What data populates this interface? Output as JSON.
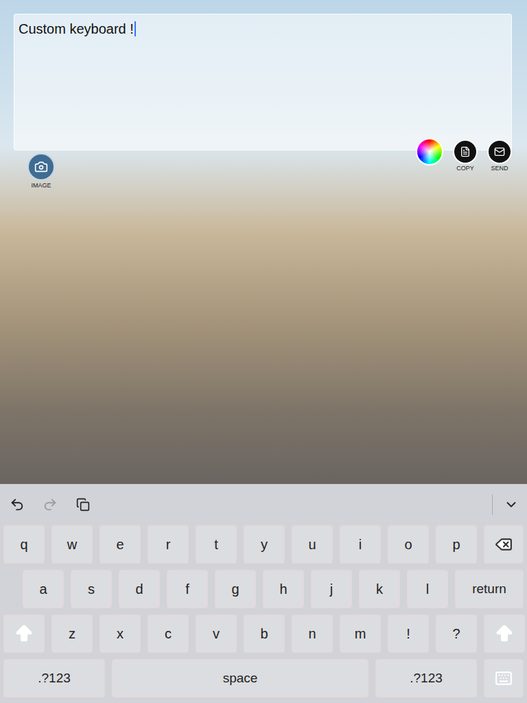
{
  "editor": {
    "text": "Custom keyboard !",
    "focused": true
  },
  "image_button": {
    "label": "IMAGE"
  },
  "actions": [
    {
      "label": "COPY",
      "kind": "copy"
    },
    {
      "label": "SEND",
      "kind": "send"
    }
  ],
  "toolbar": {
    "items": [
      {
        "kind": "undo",
        "disabled": false
      },
      {
        "kind": "redo",
        "disabled": true
      },
      {
        "kind": "paste",
        "disabled": false
      },
      {
        "kind": "collapse",
        "disabled": false
      }
    ]
  },
  "keyboard": {
    "rows": [
      [
        {
          "label": "q",
          "kind": "char"
        },
        {
          "label": "w",
          "kind": "char"
        },
        {
          "label": "e",
          "kind": "char"
        },
        {
          "label": "r",
          "kind": "char"
        },
        {
          "label": "t",
          "kind": "char"
        },
        {
          "label": "y",
          "kind": "char"
        },
        {
          "label": "u",
          "kind": "char"
        },
        {
          "label": "i",
          "kind": "char"
        },
        {
          "label": "o",
          "kind": "char"
        },
        {
          "label": "p",
          "kind": "char"
        },
        {
          "label": "",
          "kind": "delete"
        }
      ],
      [
        {
          "label": "a",
          "kind": "char"
        },
        {
          "label": "s",
          "kind": "char"
        },
        {
          "label": "d",
          "kind": "char"
        },
        {
          "label": "f",
          "kind": "char"
        },
        {
          "label": "g",
          "kind": "char"
        },
        {
          "label": "h",
          "kind": "char"
        },
        {
          "label": "j",
          "kind": "char"
        },
        {
          "label": "k",
          "kind": "char"
        },
        {
          "label": "l",
          "kind": "char"
        },
        {
          "label": "return",
          "kind": "return"
        }
      ],
      [
        {
          "label": "",
          "kind": "shift"
        },
        {
          "label": "z",
          "kind": "char"
        },
        {
          "label": "x",
          "kind": "char"
        },
        {
          "label": "c",
          "kind": "char"
        },
        {
          "label": "v",
          "kind": "char"
        },
        {
          "label": "b",
          "kind": "char"
        },
        {
          "label": "n",
          "kind": "char"
        },
        {
          "label": "m",
          "kind": "char"
        },
        {
          "label": "!",
          "kind": "char"
        },
        {
          "label": "?",
          "kind": "char"
        },
        {
          "label": "",
          "kind": "shift"
        }
      ],
      [
        {
          "label": ".?123",
          "kind": "mode"
        },
        {
          "label": "space",
          "kind": "space"
        },
        {
          "label": ".?123",
          "kind": "mode"
        },
        {
          "label": "",
          "kind": "dismiss"
        }
      ]
    ]
  }
}
